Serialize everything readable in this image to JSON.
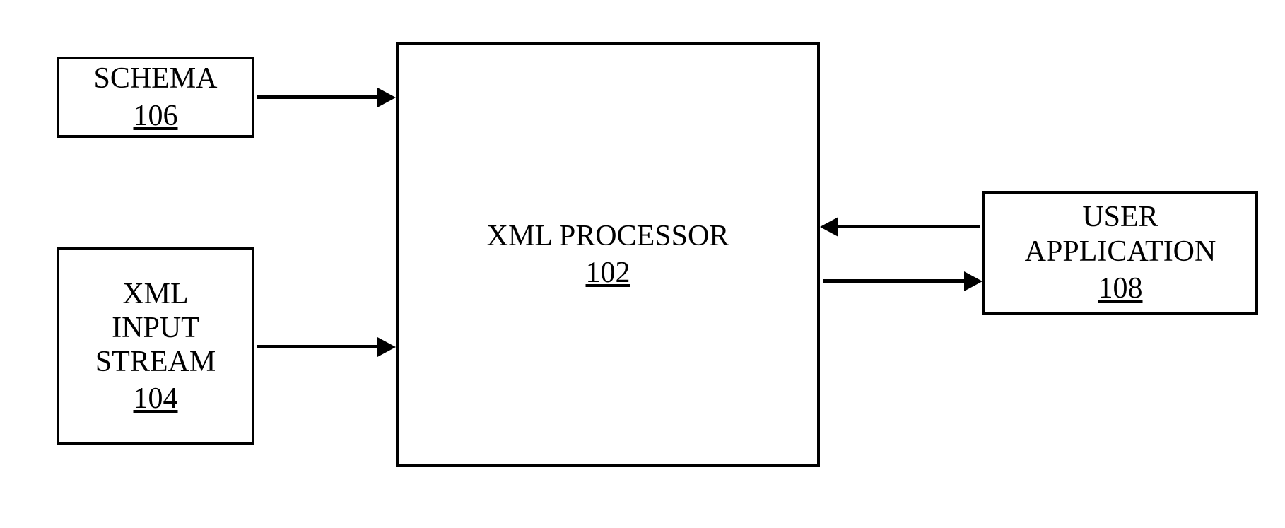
{
  "schema": {
    "label": "SCHEMA",
    "ref": "106"
  },
  "xmlInput": {
    "label": "XML\nINPUT\nSTREAM",
    "ref": "104"
  },
  "processor": {
    "label": "XML PROCESSOR",
    "ref": "102"
  },
  "userApp": {
    "label": "USER\nAPPLICATION",
    "ref": "108"
  }
}
